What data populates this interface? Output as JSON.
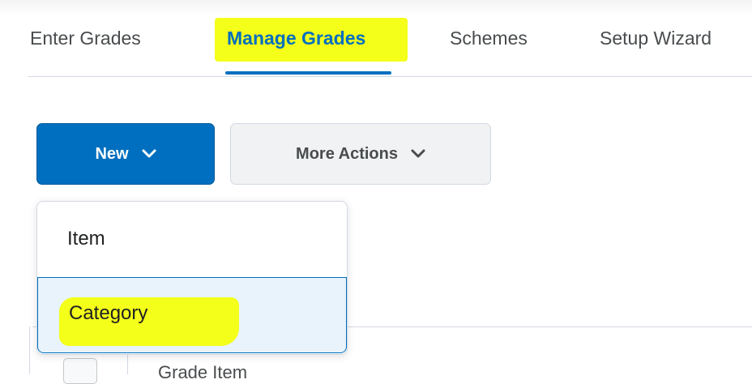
{
  "tabs": [
    {
      "label": "Enter Grades",
      "active": false
    },
    {
      "label": "Manage Grades",
      "active": true
    },
    {
      "label": "Schemes",
      "active": false
    },
    {
      "label": "Setup Wizard",
      "active": false
    }
  ],
  "toolbar": {
    "new_label": "New",
    "more_actions_label": "More Actions"
  },
  "new_menu": {
    "items": [
      {
        "label": "Item"
      },
      {
        "label": "Category",
        "hovered": true
      }
    ]
  },
  "grid": {
    "columns": [
      "Grade Item"
    ]
  },
  "colors": {
    "accent": "#006fbf",
    "highlight": "#f4ff1a",
    "menu_hover": "#e8f3fb"
  },
  "icons": [
    "chevron-down-icon",
    "checkbox-icon"
  ]
}
